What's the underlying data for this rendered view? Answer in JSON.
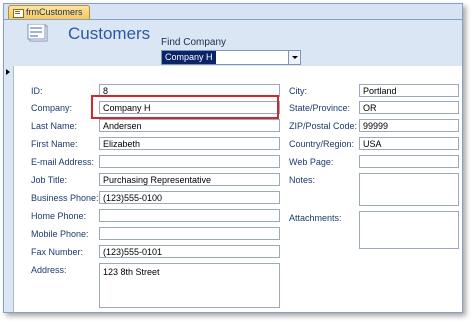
{
  "tab": {
    "label": "frmCustomers"
  },
  "header": {
    "title": "Customers",
    "find_label": "Find Company",
    "find_value": "Company H"
  },
  "fields": {
    "id": {
      "label": "ID:",
      "value": "8"
    },
    "company": {
      "label": "Company:",
      "value": "Company H"
    },
    "last_name": {
      "label": "Last Name:",
      "value": "Andersen"
    },
    "first_name": {
      "label": "First Name:",
      "value": "Elizabeth"
    },
    "email": {
      "label": "E-mail Address:",
      "value": ""
    },
    "job_title": {
      "label": "Job Title:",
      "value": "Purchasing Representative"
    },
    "business_phone": {
      "label": "Business Phone:",
      "value": "(123)555-0100"
    },
    "home_phone": {
      "label": "Home Phone:",
      "value": ""
    },
    "mobile_phone": {
      "label": "Mobile Phone:",
      "value": ""
    },
    "fax": {
      "label": "Fax Number:",
      "value": "(123)555-0101"
    },
    "address": {
      "label": "Address:",
      "value": "123 8th Street"
    },
    "city": {
      "label": "City:",
      "value": "Portland"
    },
    "state": {
      "label": "State/Province:",
      "value": "OR"
    },
    "zip": {
      "label": "ZIP/Postal Code:",
      "value": "99999"
    },
    "country": {
      "label": "Country/Region:",
      "value": "USA"
    },
    "web_page": {
      "label": "Web Page:",
      "value": ""
    },
    "notes": {
      "label": "Notes:",
      "value": ""
    },
    "attachments": {
      "label": "Attachments:",
      "value": ""
    }
  },
  "icons": {
    "tab": "form-icon",
    "header": "customers-form-icon",
    "selector": "record-selector-arrow-icon"
  }
}
